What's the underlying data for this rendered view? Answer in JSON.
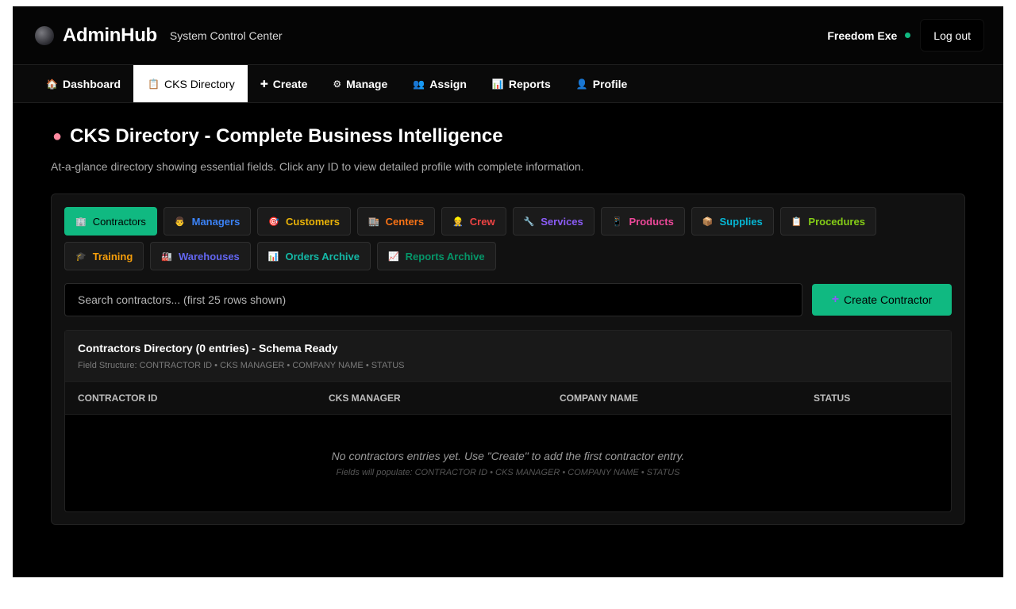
{
  "header": {
    "brand": "AdminHub",
    "tagline": "System Control Center",
    "user": "Freedom Exe",
    "logout": "Log out",
    "status_color": "#10b981"
  },
  "nav": [
    {
      "icon": "🏠",
      "icon_name": "house-icon",
      "label": "Dashboard"
    },
    {
      "icon": "📋",
      "icon_name": "clipboard-icon",
      "label": "CKS Directory",
      "active": true
    },
    {
      "icon": "✚",
      "icon_name": "plus-icon",
      "label": "Create"
    },
    {
      "icon": "⚙",
      "icon_name": "gear-icon",
      "label": "Manage"
    },
    {
      "icon": "👥",
      "icon_name": "users-icon",
      "label": "Assign"
    },
    {
      "icon": "📊",
      "icon_name": "chart-icon",
      "label": "Reports"
    },
    {
      "icon": "👤",
      "icon_name": "user-icon",
      "label": "Profile"
    }
  ],
  "page": {
    "title": "CKS Directory - Complete Business Intelligence",
    "subtitle": "At-a-glance directory showing essential fields. Click any ID to view detailed profile with complete information."
  },
  "tabs": [
    {
      "label": "Contractors",
      "icon": "🏢",
      "color": "#000000",
      "active": true
    },
    {
      "label": "Managers",
      "icon": "👨",
      "color": "#3b82f6"
    },
    {
      "label": "Customers",
      "icon": "🎯",
      "color": "#eab308"
    },
    {
      "label": "Centers",
      "icon": "🏬",
      "color": "#f97316"
    },
    {
      "label": "Crew",
      "icon": "👷",
      "color": "#ef4444"
    },
    {
      "label": "Services",
      "icon": "🔧",
      "color": "#8b5cf6"
    },
    {
      "label": "Products",
      "icon": "📱",
      "color": "#ec4899"
    },
    {
      "label": "Supplies",
      "icon": "📦",
      "color": "#06b6d4"
    },
    {
      "label": "Procedures",
      "icon": "📋",
      "color": "#84cc16"
    },
    {
      "label": "Training",
      "icon": "🎓",
      "color": "#f59e0b"
    },
    {
      "label": "Warehouses",
      "icon": "🏭",
      "color": "#6366f1"
    },
    {
      "label": "Orders Archive",
      "icon": "📊",
      "color": "#14b8a6"
    },
    {
      "label": "Reports Archive",
      "icon": "📈",
      "color": "#059669"
    }
  ],
  "search": {
    "placeholder": "Search contractors... (first 25 rows shown)",
    "create_label": "Create Contractor"
  },
  "table": {
    "title": "Contractors Directory (0 entries) - Schema Ready",
    "schema": "Field Structure: CONTRACTOR ID • CKS MANAGER • COMPANY NAME • STATUS",
    "columns": [
      "CONTRACTOR ID",
      "CKS MANAGER",
      "COMPANY NAME",
      "STATUS"
    ],
    "empty_main": "No contractors entries yet. Use \"Create\" to add the first contractor entry.",
    "empty_sub": "Fields will populate: CONTRACTOR ID • CKS MANAGER • COMPANY NAME • STATUS"
  },
  "colors": {
    "accent": "#10b981",
    "background": "#000000"
  }
}
